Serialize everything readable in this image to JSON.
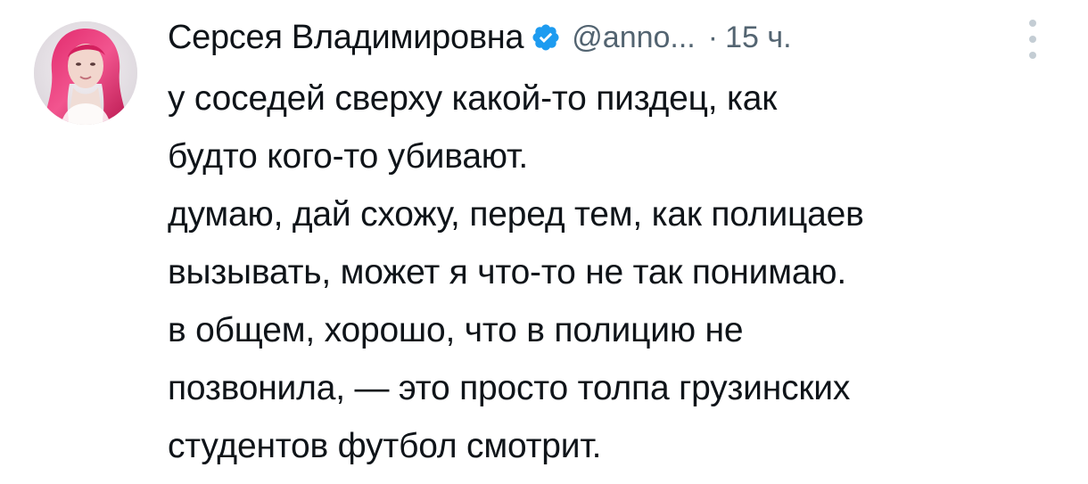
{
  "tweet": {
    "author": {
      "display_name": "Серсея Владимировна",
      "handle": "@anno...",
      "verified": true,
      "verified_color": "#1d9bf0"
    },
    "separator": "·",
    "time": "15 ч.",
    "more_icon": "vertical-dots-icon",
    "lines": [
      "у соседей сверху какой-то пиздец, как",
      "будто кого-то убивают.",
      "думаю, дай схожу, перед тем, как полицаев",
      "вызывать, может я что-то не так понимаю.",
      "в общем, хорошо, что в полицию не",
      "позвонила, — это просто толпа грузинских",
      "студентов футбол смотрит."
    ]
  }
}
